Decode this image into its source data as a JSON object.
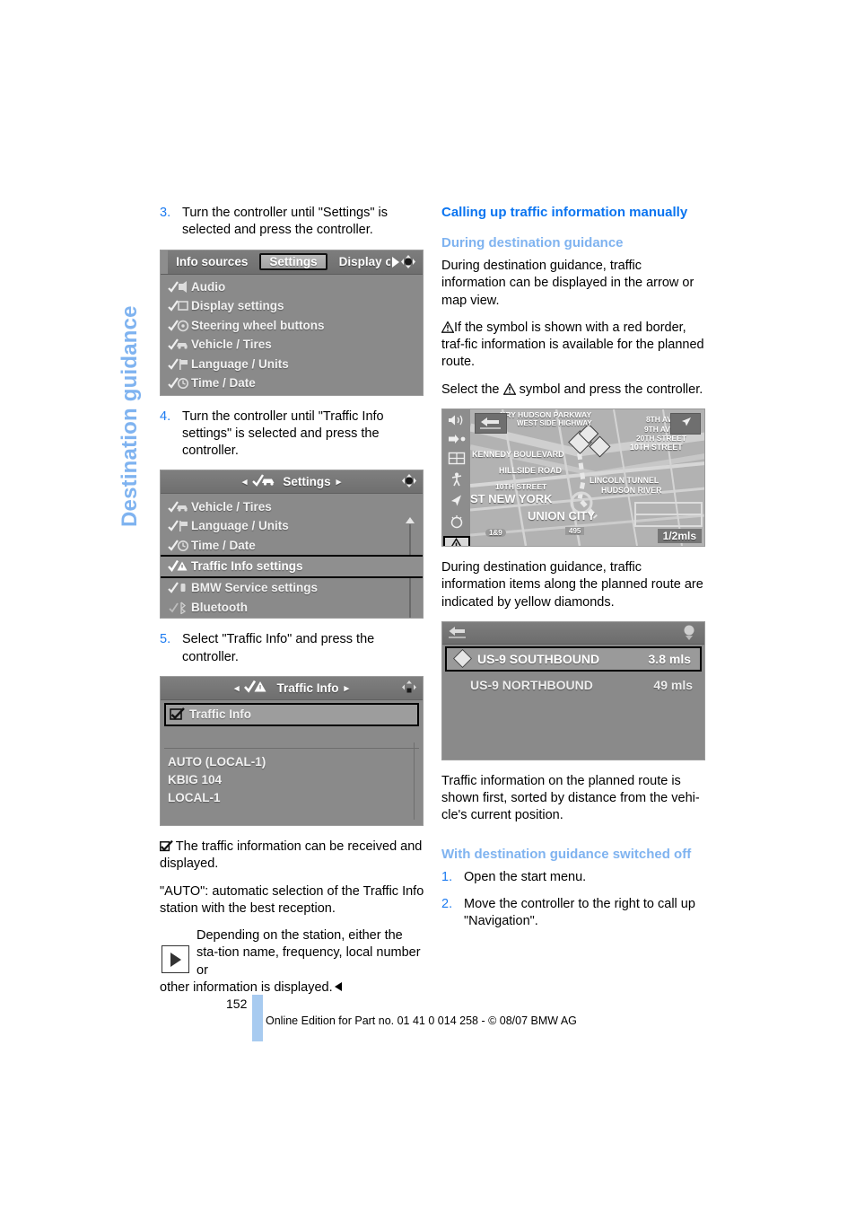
{
  "page": {
    "side_tab_label": "Destination guidance",
    "page_number": "152",
    "footer_text": "Online Edition for Part no. 01 41 0 014 258 - © 08/07 BMW AG"
  },
  "left_column": {
    "step3": {
      "num": "3.",
      "text": "Turn the controller until \"Settings\" is selected and press the controller."
    },
    "step4": {
      "num": "4.",
      "text": "Turn the controller until \"Traffic Info settings\" is selected and press the controller."
    },
    "step5": {
      "num": "5.",
      "text": "Select \"Traffic Info\" and press the controller."
    },
    "note_checkbox": "The traffic information can be received and displayed.",
    "note_auto": "\"AUTO\": automatic selection of the Traffic Info station with the best reception.",
    "note_tip_a": "Depending on the station, either the sta-tion name, frequency, local number or",
    "note_tip_b": "other information is displayed."
  },
  "screenshot_settings_tabs": {
    "tabs": [
      {
        "label": "Info sources",
        "selected": false
      },
      {
        "label": "Settings",
        "selected": true
      },
      {
        "label": "Display o",
        "selected": false
      }
    ],
    "rows": [
      {
        "label": "Audio",
        "icon": "check-speaker-icon"
      },
      {
        "label": "Display settings",
        "icon": "check-display-icon"
      },
      {
        "label": "Steering wheel buttons",
        "icon": "check-steering-wheel-icon"
      },
      {
        "label": "Vehicle / Tires",
        "icon": "check-car-icon"
      },
      {
        "label": "Language / Units",
        "icon": "check-flag-icon"
      },
      {
        "label": "Time / Date",
        "icon": "check-clock-icon"
      }
    ]
  },
  "screenshot_settings_list": {
    "title": "Settings",
    "rows": [
      {
        "label": "Vehicle / Tires",
        "icon": "check-car-icon",
        "selected": false
      },
      {
        "label": "Language / Units",
        "icon": "check-flag-icon",
        "selected": false
      },
      {
        "label": "Time / Date",
        "icon": "check-clock-icon",
        "selected": false
      },
      {
        "label": "Traffic Info settings",
        "icon": "check-warning-triangle-icon",
        "selected": true
      },
      {
        "label": "BMW Service settings",
        "icon": "check-service-icon",
        "selected": false
      },
      {
        "label": "Bluetooth",
        "icon": "bluetooth-icon",
        "selected": false
      }
    ]
  },
  "screenshot_traffic_info": {
    "title": "Traffic Info",
    "toggle_row": {
      "label": "Traffic Info",
      "checked": true
    },
    "stations": [
      "AUTO (LOCAL-1)",
      "KBIG 104",
      "LOCAL-1"
    ]
  },
  "right_column": {
    "heading_main": "Calling up traffic information manually",
    "heading_sub_1": "During destination guidance",
    "para_1": "During destination guidance, traffic information can be displayed in the arrow or map view.",
    "note_warn": "If the symbol is shown with a red border, traf-fic information is available for the planned route.",
    "para_select_a": "Select the",
    "para_select_b": "symbol and press the controller.",
    "para_2": "During destination guidance, traffic information items along the planned route are indicated by yellow diamonds.",
    "para_3": "Traffic information on the planned route is shown first, sorted by distance from the vehi-cle's current position.",
    "heading_sub_2": "With destination guidance switched off",
    "step1": {
      "num": "1.",
      "text": "Open the start menu."
    },
    "step2": {
      "num": "2.",
      "text": "Move the controller to the right to call up \"Navigation\"."
    }
  },
  "screenshot_map": {
    "scale_label": "1/2mls",
    "labels": [
      "NRY HUDSON PARKWAY",
      "WEST SIDE HIGHWAY",
      "8TH AV",
      "9TH AV",
      "20TH STREET",
      "10TH STREET",
      "KENNEDY BOULEVARD",
      "HILLSIDE ROAD",
      "10TH STREET",
      "LINCOLN TUNNEL",
      "HUDSON RIVER",
      "ST NEW YORK",
      "UNION CITY"
    ],
    "shields": [
      "1&9",
      "495"
    ],
    "sidebar_icons": [
      "speaker-icon",
      "arrow-dot-icon",
      "split-screen-icon",
      "pedestrian-icon",
      "north-arrow-icon",
      "compass-icon",
      "traffic-warning-icon"
    ]
  },
  "screenshot_traffic_list": {
    "items": [
      {
        "name": "US-9 SOUTHBOUND",
        "distance": "3.8 mls",
        "selected": true
      },
      {
        "name": "US-9 NORTHBOUND",
        "distance": "49 mls",
        "selected": false
      }
    ]
  },
  "colors": {
    "heading_main": "#0A74F0",
    "heading_sub": "#7FB3F0",
    "step_number": "#1D7BF0",
    "side_tab": "#7FB3F0",
    "footer_bar": "#A8CBF0"
  }
}
